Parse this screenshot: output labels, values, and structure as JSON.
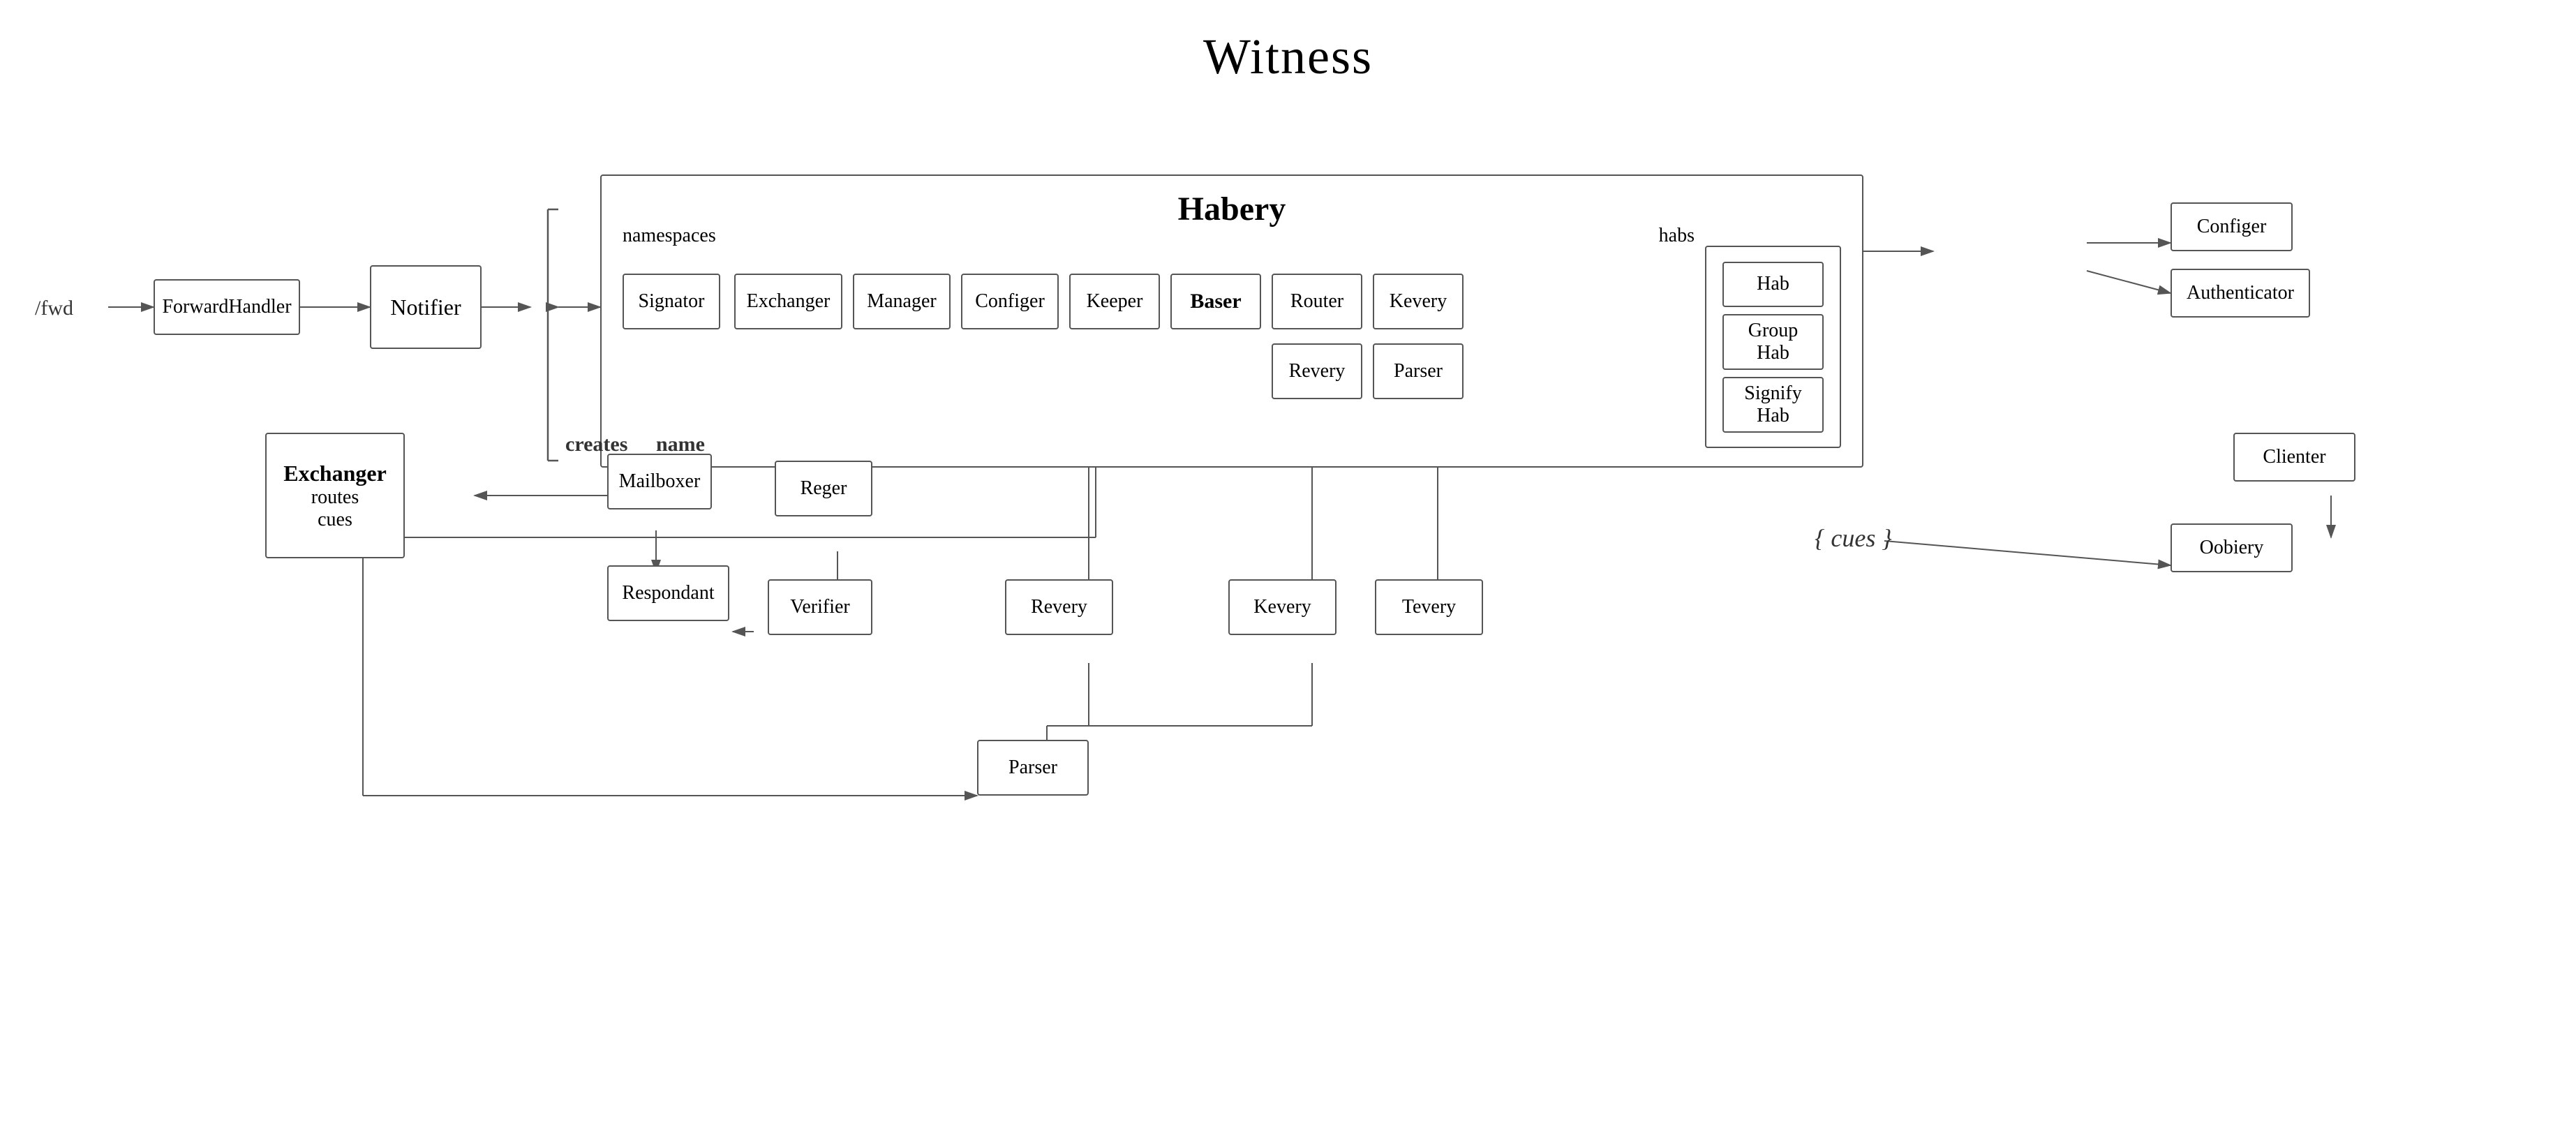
{
  "title": "Witness",
  "nodes": {
    "fwd_label": "/fwd",
    "forward_handler": "ForwardHandler",
    "notifier": "Notifier",
    "habery_title": "Habery",
    "namespaces_label": "namespaces",
    "habs_label": "habs",
    "signator": "Signator",
    "exchanger_ns": "Exchanger",
    "manager": "Manager",
    "configer_ns": "Configer",
    "keeper": "Keeper",
    "baser": "Baser",
    "router": "Router",
    "kevery_ns": "Kevery",
    "revery_ns": "Revery",
    "parser_ns": "Parser",
    "hab": "Hab",
    "group_hab": "Group\nHab",
    "signify_hab": "Signify\nHab",
    "configer_habs": "Configer",
    "authenticator": "Authenticator",
    "clienter": "Clienter",
    "oobiery": "Oobiery",
    "exchanger_main": "Exchanger",
    "exchanger_sub1": "routes",
    "exchanger_sub2": "cues",
    "mailboxer": "Mailboxer",
    "respondant": "Respondant",
    "reger": "Reger",
    "verifier": "Verifier",
    "revery_main": "Revery",
    "kevery_main": "Kevery",
    "tevery": "Tevery",
    "parser_main": "Parser",
    "creates_label": "creates",
    "name_label": "name",
    "cues_label": "{ cues }"
  }
}
